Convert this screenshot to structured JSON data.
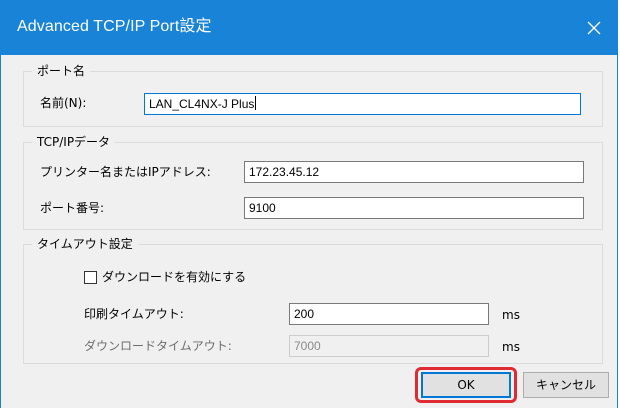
{
  "dialog": {
    "title": "Advanced TCP/IP Port設定",
    "close_glyph": "✕"
  },
  "port_name_group": {
    "legend": "ポート名",
    "name_label": "名前(N):",
    "name_value": "LAN_CL4NX-J Plus"
  },
  "tcpip_group": {
    "legend": "TCP/IPデータ",
    "address_label": "プリンター名またはIPアドレス:",
    "address_value": "172.23.45.12",
    "port_label": "ポート番号:",
    "port_value": "9100"
  },
  "timeout_group": {
    "legend": "タイムアウト設定",
    "download_checkbox_label": "ダウンロードを有効にする",
    "download_checked": false,
    "print_timeout_label": "印刷タイムアウト:",
    "print_timeout_value": "200",
    "print_timeout_unit": "ms",
    "download_timeout_label": "ダウンロードタイムアウト:",
    "download_timeout_value": "7000",
    "download_timeout_unit": "ms"
  },
  "buttons": {
    "ok_label": "OK",
    "cancel_label": "キャンセル"
  },
  "colors": {
    "titlebar": "#1883d7",
    "highlight": "#e02b35",
    "focus_border": "#0078d7"
  }
}
